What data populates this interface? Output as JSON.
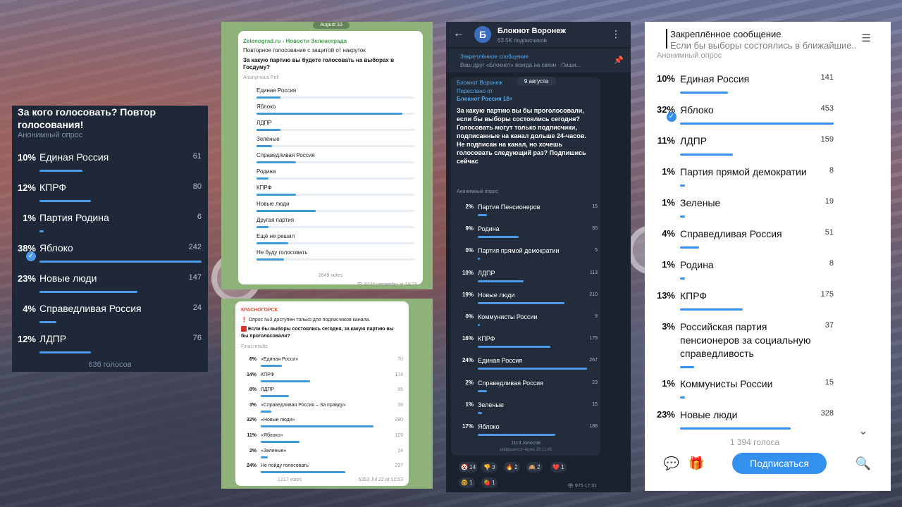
{
  "panel1": {
    "title": "За кого голосовать? Повтор голосования!",
    "poll_type": "Анонимный опрос",
    "options": [
      {
        "pct": "10%",
        "label": "Единая Россия",
        "count": "61",
        "value": 0.1
      },
      {
        "pct": "12%",
        "label": "КПРФ",
        "count": "80",
        "value": 0.12
      },
      {
        "pct": "1%",
        "label": "Партия Родина",
        "count": "6",
        "value": 0.01
      },
      {
        "pct": "38%",
        "label": "Яблоко",
        "count": "242",
        "value": 0.38,
        "chosen": true
      },
      {
        "pct": "23%",
        "label": "Новые люди",
        "count": "147",
        "value": 0.23
      },
      {
        "pct": "4%",
        "label": "Справедливая Россия",
        "count": "24",
        "value": 0.04
      },
      {
        "pct": "12%",
        "label": "ЛДПР",
        "count": "76",
        "value": 0.12
      }
    ],
    "total": "636 голосов"
  },
  "panel2": {
    "date": "August 10",
    "source": "Zelenograd.ru - Новости Зеленограда",
    "line1": "Повторное голосование с защитой от накруток",
    "question": "За какую партию вы будете голосовать на выборах в Госдуму?",
    "poll_type": "Anonymous Poll",
    "options": [
      {
        "label": "Единая Россия",
        "value": 0.06
      },
      {
        "label": "Яблоко",
        "value": 0.37
      },
      {
        "label": "ЛДПР",
        "value": 0.06
      },
      {
        "label": "Зелёные",
        "value": 0.04
      },
      {
        "label": "Справедливая Россия",
        "value": 0.1
      },
      {
        "label": "Родина",
        "value": 0.03
      },
      {
        "label": "КПРФ",
        "value": 0.1
      },
      {
        "label": "Новые люди",
        "value": 0.15
      },
      {
        "label": "Другая партия",
        "value": 0.03
      },
      {
        "label": "Ещё не решил",
        "value": 0.08
      },
      {
        "label": "Не буду голосовать",
        "value": 0.07
      }
    ],
    "votes": "2849 votes",
    "views": "8740",
    "time": "yesterday at 18:28"
  },
  "panel3": {
    "header": "КРАСНОГОРСК",
    "notice": "❗ Опрос №3 доступен только для подписчиков канала.",
    "question": "Если бы выборы состоялись сегодня, за какую партию вы бы проголосовали?",
    "result_label": "Final results",
    "options": [
      {
        "pct": "6%",
        "label": "«Единая Росси»",
        "count": "70",
        "value": 0.06
      },
      {
        "pct": "14%",
        "label": "КПРФ",
        "count": "174",
        "value": 0.14
      },
      {
        "pct": "8%",
        "label": "ЛДПР",
        "count": "95",
        "value": 0.08
      },
      {
        "pct": "3%",
        "label": "«Справедливая Россия – За правду»",
        "count": "38",
        "value": 0.03
      },
      {
        "pct": "32%",
        "label": "«Новые люди»",
        "count": "390",
        "value": 0.32
      },
      {
        "pct": "11%",
        "label": "«Яблоко»",
        "count": "129",
        "value": 0.11
      },
      {
        "pct": "2%",
        "label": "«Зеленые»",
        "count": "24",
        "value": 0.02
      },
      {
        "pct": "24%",
        "label": "Не пойду голосовать",
        "count": "297",
        "value": 0.24
      }
    ],
    "votes": "1217 votes",
    "meta": "6353 Jul 22 at 12:53"
  },
  "panel4": {
    "channel": "Блокнот Воронеж",
    "subscribers": "63.5K подписчиков",
    "pinned_title": "Закреплённое сообщение",
    "pinned_text": "Ваш друг «Блокнот» всегда на связи · Пиши...",
    "date": "9 августа",
    "author": "Блокнот Воронеж",
    "forwarded": "Переслано от",
    "forwarded_from": "Блокнот Россия 18+",
    "question": "За какую партию вы бы проголосовали, если бы выборы состоялись сегодня? Голосовать могут только подписчики, подписанные на канал дольше 24-часов. Не подписан на канал, но хочешь голосовать следующий раз? Подпишись сейчас",
    "poll_type": "Анонимный опрос",
    "options": [
      {
        "pct": "2%",
        "label": "Партия Пенсионеров",
        "count": "15",
        "value": 0.02
      },
      {
        "pct": "9%",
        "label": "Родина",
        "count": "93",
        "value": 0.09
      },
      {
        "pct": "0%",
        "label": "Партия прямой демократии",
        "count": "5",
        "value": 0.0
      },
      {
        "pct": "10%",
        "label": "ЛДПР",
        "count": "113",
        "value": 0.1
      },
      {
        "pct": "19%",
        "label": "Новые люди",
        "count": "210",
        "value": 0.19
      },
      {
        "pct": "0%",
        "label": "Коммунисты России",
        "count": "9",
        "value": 0.0
      },
      {
        "pct": "16%",
        "label": "КПРФ",
        "count": "175",
        "value": 0.16
      },
      {
        "pct": "24%",
        "label": "Единая Россия",
        "count": "267",
        "value": 0.24
      },
      {
        "pct": "2%",
        "label": "Справедливая Россия",
        "count": "23",
        "value": 0.02
      },
      {
        "pct": "1%",
        "label": "Зеленые",
        "count": "15",
        "value": 0.01
      },
      {
        "pct": "17%",
        "label": "Яблоко",
        "count": "188",
        "value": 0.17
      }
    ],
    "total": "1113 голосов",
    "closes": "завершится через 20:11:45",
    "reactions": [
      {
        "emoji": "🤡",
        "count": "14"
      },
      {
        "emoji": "👎",
        "count": "3"
      },
      {
        "emoji": "🔥",
        "count": "2"
      },
      {
        "emoji": "🙉",
        "count": "2"
      },
      {
        "emoji": "❤️",
        "count": "1"
      },
      {
        "emoji": "🤓",
        "count": "1"
      },
      {
        "emoji": "🍓",
        "count": "1"
      }
    ],
    "meta": "975 17:31"
  },
  "panel5": {
    "pinned_title": "Закреплённое сообщение",
    "pinned_text": "Если бы выборы состоялись в ближайшие...",
    "poll_type": "Анонимный опрос",
    "options": [
      {
        "pct": "10%",
        "label": "Единая Россия",
        "count": "141",
        "value": 0.1
      },
      {
        "pct": "32%",
        "label": "Яблоко",
        "count": "453",
        "value": 0.32,
        "chosen": true
      },
      {
        "pct": "11%",
        "label": "ЛДПР",
        "count": "159",
        "value": 0.11
      },
      {
        "pct": "1%",
        "label": "Партия прямой демократии",
        "count": "8",
        "value": 0.01
      },
      {
        "pct": "1%",
        "label": "Зеленые",
        "count": "19",
        "value": 0.01
      },
      {
        "pct": "4%",
        "label": "Справедливая Россия",
        "count": "51",
        "value": 0.04
      },
      {
        "pct": "1%",
        "label": "Родина",
        "count": "8",
        "value": 0.01
      },
      {
        "pct": "13%",
        "label": "КПРФ",
        "count": "175",
        "value": 0.13
      },
      {
        "pct": "3%",
        "label": "Российская партия пенсионеров за социальную справедливость",
        "count": "37",
        "value": 0.03
      },
      {
        "pct": "1%",
        "label": "Коммунисты России",
        "count": "15",
        "value": 0.01
      },
      {
        "pct": "23%",
        "label": "Новые люди",
        "count": "328",
        "value": 0.23
      }
    ],
    "total": "1 394 голоса",
    "subscribe_label": "Подписаться"
  }
}
